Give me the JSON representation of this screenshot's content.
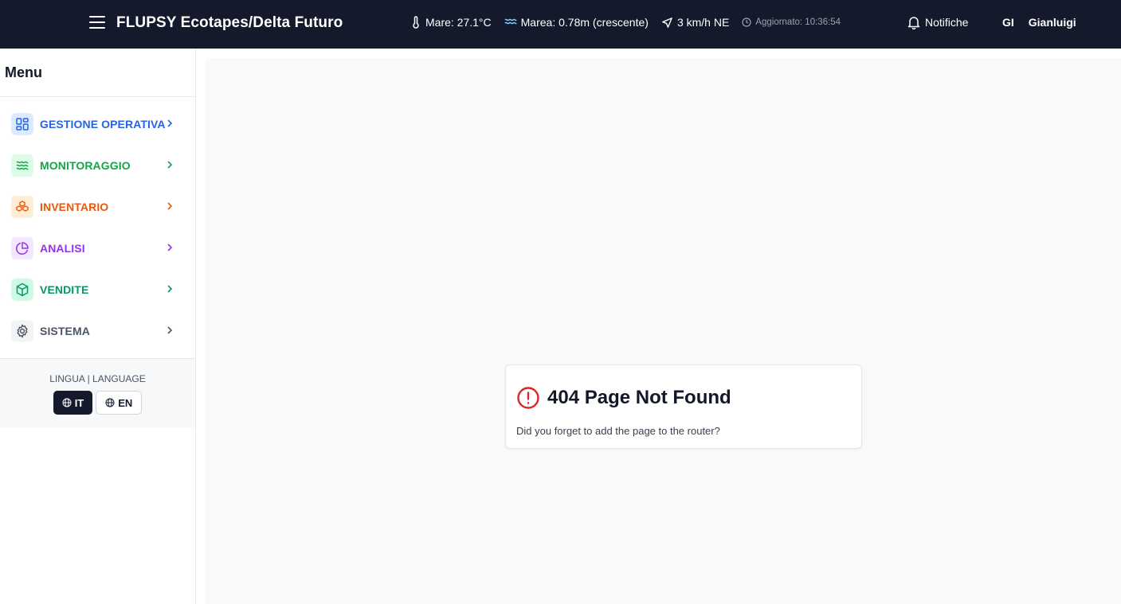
{
  "header": {
    "title": "FLUPSY Ecotapes/Delta Futuro",
    "sea_temp": "Mare: 27.1°C",
    "tide": "Marea: 0.78m (crescente)",
    "wind": "3 km/h NE",
    "updated": "Aggiornato: 10:36:54",
    "notifications_label": "Notifiche",
    "user_initials": "GI",
    "user_name": "Gianluigi"
  },
  "sidebar": {
    "title": "Menu",
    "items": [
      {
        "label": "GESTIONE OPERATIVA",
        "icon": "dashboard-grid-icon",
        "color": "#2563eb",
        "bg": "#dbeafe"
      },
      {
        "label": "MONITORAGGIO",
        "icon": "waves-icon",
        "color": "#16a34a",
        "bg": "#dcfce7"
      },
      {
        "label": "INVENTARIO",
        "icon": "boxes-icon",
        "color": "#ea580c",
        "bg": "#ffedd5"
      },
      {
        "label": "ANALISI",
        "icon": "pie-chart-icon",
        "color": "#9333ea",
        "bg": "#f3e8ff"
      },
      {
        "label": "VENDITE",
        "icon": "package-icon",
        "color": "#059669",
        "bg": "#d1fae5"
      },
      {
        "label": "SISTEMA",
        "icon": "gear-icon",
        "color": "#4b5563",
        "bg": "#f3f4f6"
      }
    ],
    "language": {
      "title": "LINGUA | LANGUAGE",
      "options": [
        {
          "label": "IT",
          "active": true
        },
        {
          "label": "EN",
          "active": false
        }
      ]
    }
  },
  "main": {
    "error_title": "404 Page Not Found",
    "error_message": "Did you forget to add the page to the router?",
    "error_color": "#dc2626"
  }
}
